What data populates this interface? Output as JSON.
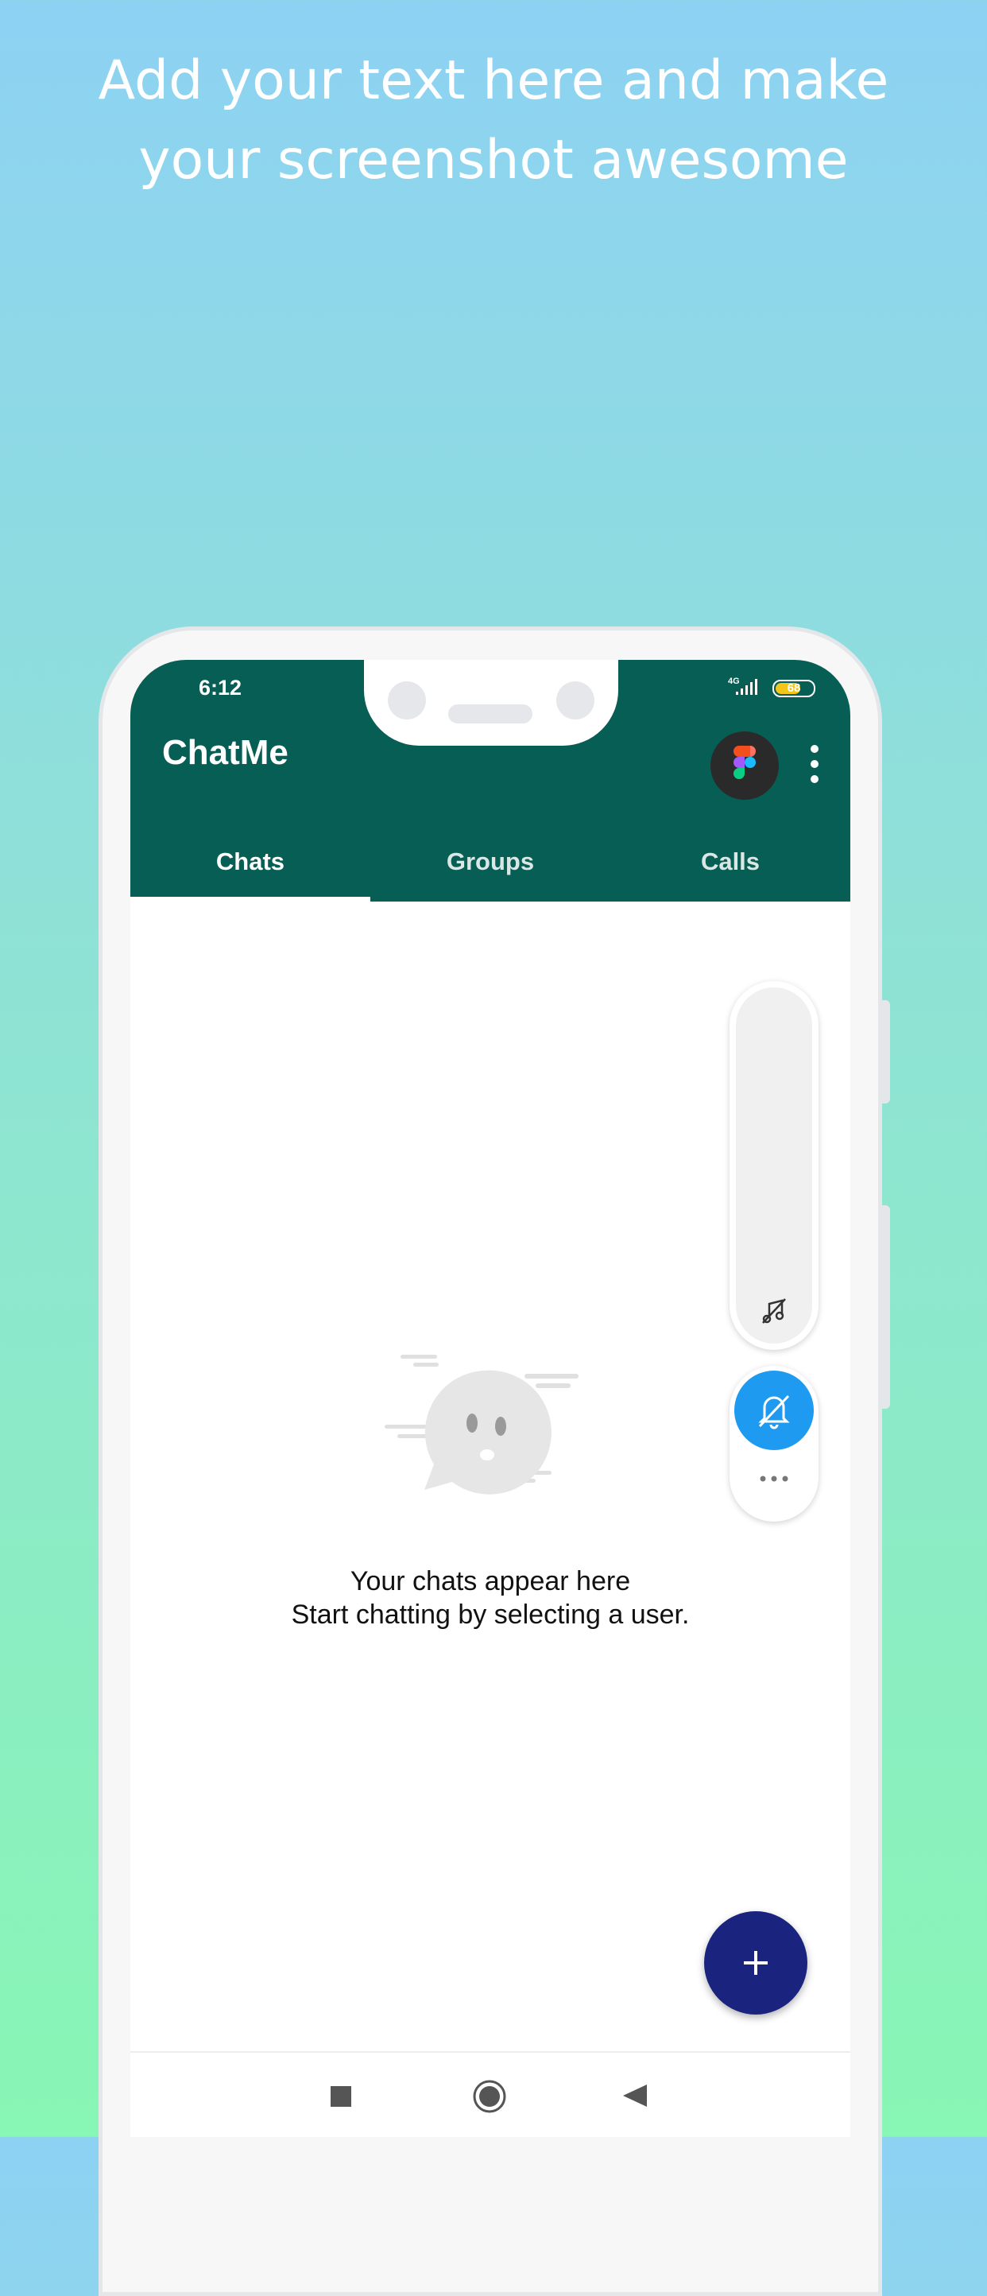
{
  "promo": {
    "line1": "Add your text here and make",
    "line2": "your screenshot awesome"
  },
  "status_bar": {
    "time": "6:12",
    "network": "4G",
    "battery": "68",
    "battery_level": 0.68
  },
  "app": {
    "title": "ChatMe"
  },
  "tabs": [
    {
      "label": "Chats",
      "active": true
    },
    {
      "label": "Groups",
      "active": false
    },
    {
      "label": "Calls",
      "active": false
    }
  ],
  "icons": {
    "avatar": "figma-logo-icon",
    "menu": "more-vert-icon",
    "music_off": "music-off-icon",
    "bell_off": "bell-off-icon",
    "more": "more-horiz-icon",
    "fab": "plus-icon",
    "nav_recents": "square-icon",
    "nav_home": "circle-icon",
    "nav_back": "triangle-back-icon"
  },
  "empty_state": {
    "line1": "Your chats appear here",
    "line2": "Start chatting by selecting a user."
  },
  "colors": {
    "appbar": "#075e54",
    "fab": "#1a237e",
    "bell_button": "#1e9bf0"
  }
}
